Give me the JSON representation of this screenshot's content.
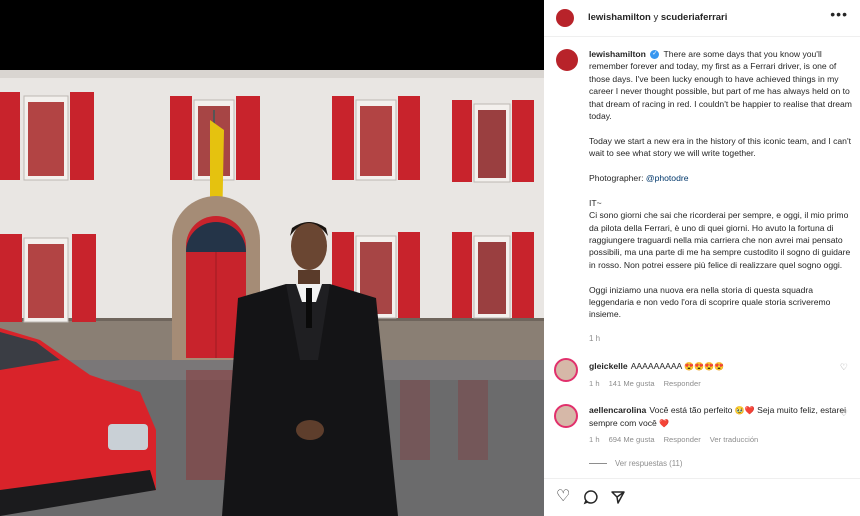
{
  "header": {
    "user1": "lewishamilton",
    "joiner": " y ",
    "user2": "scuderiaferrari",
    "more_icon": "more-icon"
  },
  "caption": {
    "username": "lewishamilton",
    "verified": "✓",
    "paragraphs": [
      "There are some days that you know you'll remember forever and today, my first as a Ferrari driver, is one of those days. I've been lucky enough to have achieved things in my career I never thought possible, but part of me has always held on to that dream of racing in red. I couldn't be happier to realise that dream today.",
      "Today we start a new era in the history of this iconic team, and I can't wait to see what story we will write together.",
      "Photographer: ",
      "IT~\nCi sono giorni che sai che ricorderai per sempre, e oggi, il mio primo da pilota della Ferrari, è uno di quei giorni. Ho avuto la fortuna di raggiungere traguardi nella mia carriera che non avrei mai pensato possibili, ma una parte di me ha sempre custodito il sogno di guidare in rosso. Non potrei essere più felice di realizzare quel sogno oggi.",
      "Oggi iniziamo una nuova era nella storia di questa squadra leggendaria e non vedo l'ora di scoprire quale storia scriveremo insieme."
    ],
    "photographer_handle": "@photodre",
    "time": "1 h"
  },
  "comments": [
    {
      "username": "gleickelle",
      "text": "AAAAAAAAA ",
      "emojis": "😍😍😍😍",
      "time": "1 h",
      "likes": "141 Me gusta",
      "reply": "Responder",
      "translate": ""
    },
    {
      "username": "aellencarolina",
      "text": "Você está tão perfeito ",
      "emojis": "🥹❤️",
      "text2": " Seja muito feliz, estarei sempre com você ",
      "emoji2": "❤️",
      "time": "1 h",
      "likes": "694 Me gusta",
      "reply": "Responder",
      "translate": "Ver traducción"
    }
  ],
  "view_replies": "Ver respuestas (11)",
  "actions": {
    "like_icon": "heart-icon",
    "comment_icon": "comment-icon",
    "share_icon": "share-icon"
  },
  "colors": {
    "ferrari_red": "#c8232c",
    "verified_blue": "#3897f0",
    "mention": "#00376b"
  }
}
